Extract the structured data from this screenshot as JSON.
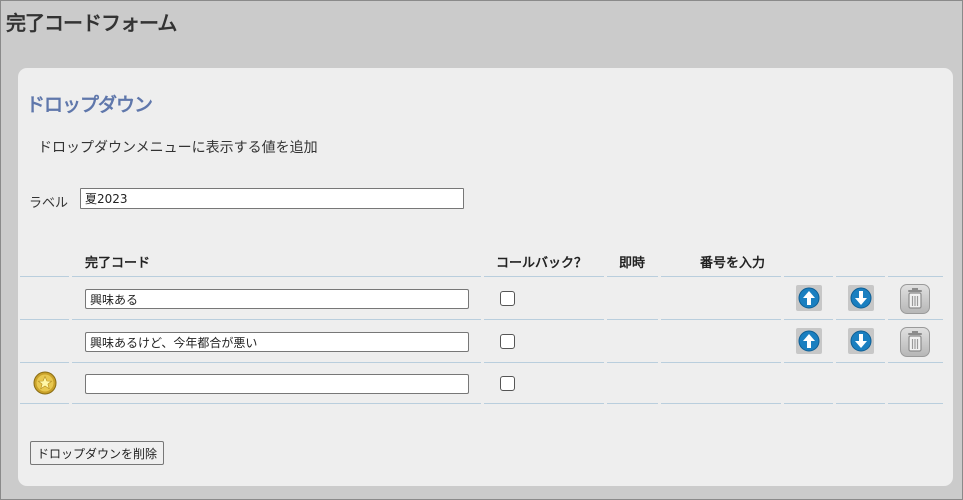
{
  "page": {
    "title": "完了コードフォーム"
  },
  "section": {
    "title": "ドロップダウン",
    "description": "ドロップダウンメニューに表示する値を追加",
    "label_caption": "ラベル",
    "label_value": "夏2023"
  },
  "table": {
    "headers": {
      "code": "完了コード",
      "callback": "コールバック？",
      "immediate": "即時",
      "enter_number": "番号を入力"
    },
    "rows": [
      {
        "code": "興味ある",
        "callback": false
      },
      {
        "code": "興味あるけど、今年都合が悪い",
        "callback": false
      }
    ],
    "new_row": {
      "code": "",
      "callback": false
    }
  },
  "actions": {
    "delete_dropdown": "ドロップダウンを削除"
  },
  "icons": {
    "move_up": "arrow-up-icon",
    "move_down": "arrow-down-icon",
    "delete": "trash-icon",
    "new": "star-icon"
  },
  "colors": {
    "section_title": "#5f77ab",
    "arrow_blue": "#1a7fc0",
    "grid_line": "#b9cedd"
  }
}
